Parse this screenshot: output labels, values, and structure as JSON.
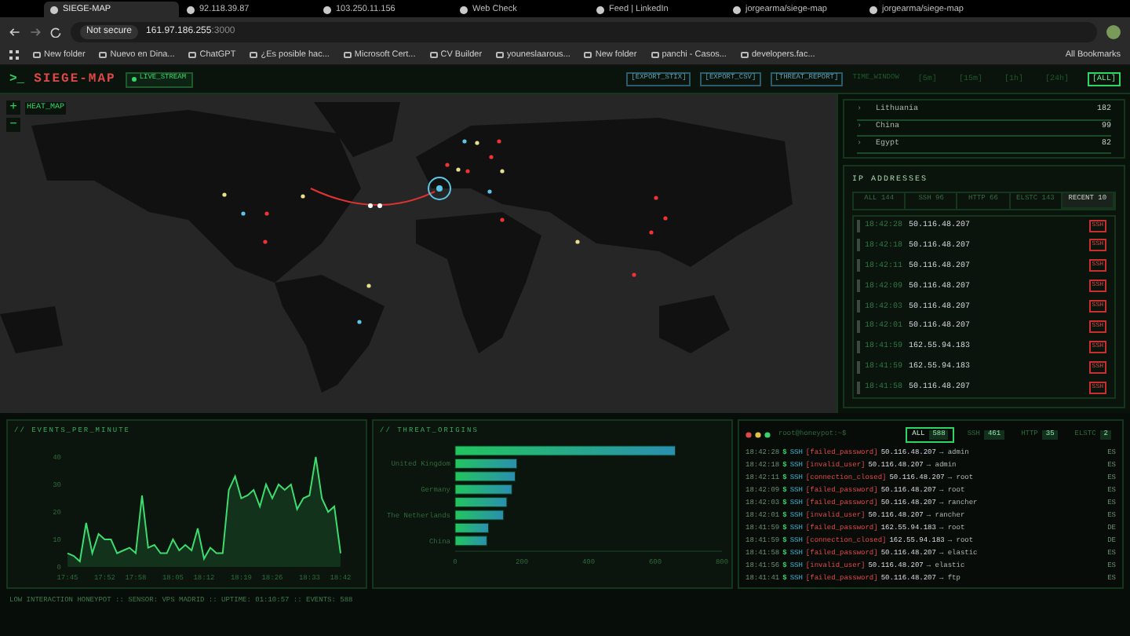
{
  "browser": {
    "tabs": [
      {
        "title": "SIEGE-MAP",
        "selected": true
      },
      {
        "title": "92.118.39.87",
        "selected": false
      },
      {
        "title": "103.250.11.156",
        "selected": false
      },
      {
        "title": "Web Check",
        "selected": false
      },
      {
        "title": "Feed | LinkedIn",
        "selected": false
      },
      {
        "title": "jorgearma/siege-map",
        "selected": false
      },
      {
        "title": "jorgearma/siege-map",
        "selected": false
      }
    ],
    "security": "Not secure",
    "url_host": "161.97.186.255",
    "url_port": ":3000",
    "bookmarks": [
      "New folder",
      "Nuevo en Dina...",
      "ChatGPT",
      "¿Es posible hac...",
      "Microsoft Cert...",
      "CV Builder",
      "youneslaarous...",
      "New folder",
      "panchi - Casos...",
      "developers.fac..."
    ],
    "all_bookmarks": "All Bookmarks"
  },
  "header": {
    "logo_prompt": ">_",
    "logo": "SIEGE-MAP",
    "live": "LIVE_STREAM",
    "actions": [
      "[EXPORT_STIX]",
      "[EXPORT_CSV]",
      "[THREAT_REPORT]"
    ],
    "time_label": "TIME_WINDOW",
    "windows": [
      {
        "label": "[5m]",
        "selected": false
      },
      {
        "label": "[15m]",
        "selected": false
      },
      {
        "label": "[1h]",
        "selected": false
      },
      {
        "label": "[24h]",
        "selected": false
      },
      {
        "label": "[ALL]",
        "selected": true
      }
    ]
  },
  "map": {
    "title": "HEAT_MAP",
    "zoom_in": "+",
    "zoom_out": "−"
  },
  "countries": [
    {
      "arrow": "›",
      "name": "Lithuania",
      "count": "182"
    },
    {
      "arrow": "›",
      "name": "China",
      "count": "99"
    },
    {
      "arrow": "›",
      "name": "Egypt",
      "count": "82"
    }
  ],
  "ip_panel": {
    "title": "IP ADDRESSES",
    "tabs": [
      {
        "label": "ALL 144",
        "selected": false
      },
      {
        "label": "SSH 96",
        "selected": false
      },
      {
        "label": "HTTP 66",
        "selected": false
      },
      {
        "label": "ELSTC 143",
        "selected": false
      },
      {
        "label": "RECENT 10",
        "selected": true
      }
    ],
    "rows": [
      {
        "time": "18:42:28",
        "ip": "50.116.48.207",
        "tag": "SSH"
      },
      {
        "time": "18:42:18",
        "ip": "50.116.48.207",
        "tag": "SSH"
      },
      {
        "time": "18:42:11",
        "ip": "50.116.48.207",
        "tag": "SSH"
      },
      {
        "time": "18:42:09",
        "ip": "50.116.48.207",
        "tag": "SSH"
      },
      {
        "time": "18:42:03",
        "ip": "50.116.48.207",
        "tag": "SSH"
      },
      {
        "time": "18:42:01",
        "ip": "50.116.48.207",
        "tag": "SSH"
      },
      {
        "time": "18:41:59",
        "ip": "162.55.94.183",
        "tag": "SSH"
      },
      {
        "time": "18:41:59",
        "ip": "162.55.94.183",
        "tag": "SSH"
      },
      {
        "time": "18:41:58",
        "ip": "50.116.48.207",
        "tag": "SSH"
      }
    ]
  },
  "events_chart": {
    "chart_data": {
      "type": "area",
      "title": "// EVENTS_PER_MINUTE",
      "series": [
        {
          "color": "#3ddc6e",
          "values": [
            5,
            4,
            2,
            16,
            5,
            12,
            10,
            10,
            5,
            6,
            7,
            5,
            26,
            7,
            8,
            5,
            5,
            10,
            6,
            8,
            6,
            14,
            3,
            7,
            5,
            5,
            28,
            33,
            25,
            26,
            28,
            22,
            30,
            25,
            30,
            28,
            30,
            21,
            25,
            26,
            40,
            25,
            20,
            22,
            5
          ]
        }
      ],
      "ylim": [
        0,
        40
      ],
      "yticks": [
        0,
        10,
        20,
        30,
        40
      ],
      "categories": [
        "17:45",
        null,
        null,
        null,
        null,
        null,
        "17:52",
        null,
        null,
        null,
        null,
        "17:58",
        null,
        null,
        null,
        null,
        null,
        "18:05",
        null,
        null,
        null,
        null,
        "18:12",
        null,
        null,
        null,
        null,
        null,
        "18:19",
        null,
        null,
        null,
        null,
        "18:26",
        null,
        null,
        null,
        null,
        null,
        "18:33",
        null,
        null,
        null,
        null,
        "18:42"
      ]
    }
  },
  "origins_chart": {
    "chart_data": {
      "type": "bar",
      "orientation": "horizontal",
      "title": "// THREAT_ORIGINS",
      "categories": [
        null,
        "United Kingdom",
        null,
        "Germany",
        null,
        "The Netherlands",
        null,
        "China"
      ],
      "values": [
        660,
        185,
        180,
        170,
        155,
        145,
        100,
        95
      ],
      "xlim": [
        0,
        800
      ],
      "xticks": [
        0,
        200,
        400,
        600,
        800
      ]
    }
  },
  "terminal": {
    "prompt": "root@honeypot:~$",
    "filters": [
      {
        "label": "ALL",
        "count": "588",
        "selected": true
      },
      {
        "label": "SSH",
        "count": "461",
        "selected": false
      },
      {
        "label": "HTTP",
        "count": "35",
        "selected": false
      },
      {
        "label": "ELSTC",
        "count": "2",
        "selected": false
      }
    ],
    "lines": [
      {
        "time": "18:42:28",
        "symbol": "$",
        "service": "SSH",
        "event": "[failed_password]",
        "ip": "50.116.48.207",
        "user": "→ admin",
        "cc": "ES"
      },
      {
        "time": "18:42:18",
        "symbol": "$",
        "service": "SSH",
        "event": "[invalid_user]",
        "ip": "50.116.48.207",
        "user": "→ admin",
        "cc": "ES"
      },
      {
        "time": "18:42:11",
        "symbol": "$",
        "service": "SSH",
        "event": "[connection_closed]",
        "ip": "50.116.48.207",
        "user": "→ root",
        "cc": "ES"
      },
      {
        "time": "18:42:09",
        "symbol": "$",
        "service": "SSH",
        "event": "[failed_password]",
        "ip": "50.116.48.207",
        "user": "→ root",
        "cc": "ES"
      },
      {
        "time": "18:42:03",
        "symbol": "$",
        "service": "SSH",
        "event": "[failed_password]",
        "ip": "50.116.48.207",
        "user": "→ rancher",
        "cc": "ES"
      },
      {
        "time": "18:42:01",
        "symbol": "$",
        "service": "SSH",
        "event": "[invalid_user]",
        "ip": "50.116.48.207",
        "user": "→ rancher",
        "cc": "ES"
      },
      {
        "time": "18:41:59",
        "symbol": "$",
        "service": "SSH",
        "event": "[failed_password]",
        "ip": "162.55.94.183",
        "user": "→ root",
        "cc": "DE"
      },
      {
        "time": "18:41:59",
        "symbol": "$",
        "service": "SSH",
        "event": "[connection_closed]",
        "ip": "162.55.94.183",
        "user": "→ root",
        "cc": "DE"
      },
      {
        "time": "18:41:58",
        "symbol": "$",
        "service": "SSH",
        "event": "[failed_password]",
        "ip": "50.116.48.207",
        "user": "→ elastic",
        "cc": "ES"
      },
      {
        "time": "18:41:56",
        "symbol": "$",
        "service": "SSH",
        "event": "[invalid_user]",
        "ip": "50.116.48.207",
        "user": "→ elastic",
        "cc": "ES"
      },
      {
        "time": "18:41:41",
        "symbol": "$",
        "service": "SSH",
        "event": "[failed_password]",
        "ip": "50.116.48.207",
        "user": "→ ftp",
        "cc": "ES"
      }
    ]
  },
  "footer": "LOW INTERACTION HONEYPOT :: SENSOR: VPS MADRID :: UPTIME: 01:10:57 :: EVENTS: 588"
}
